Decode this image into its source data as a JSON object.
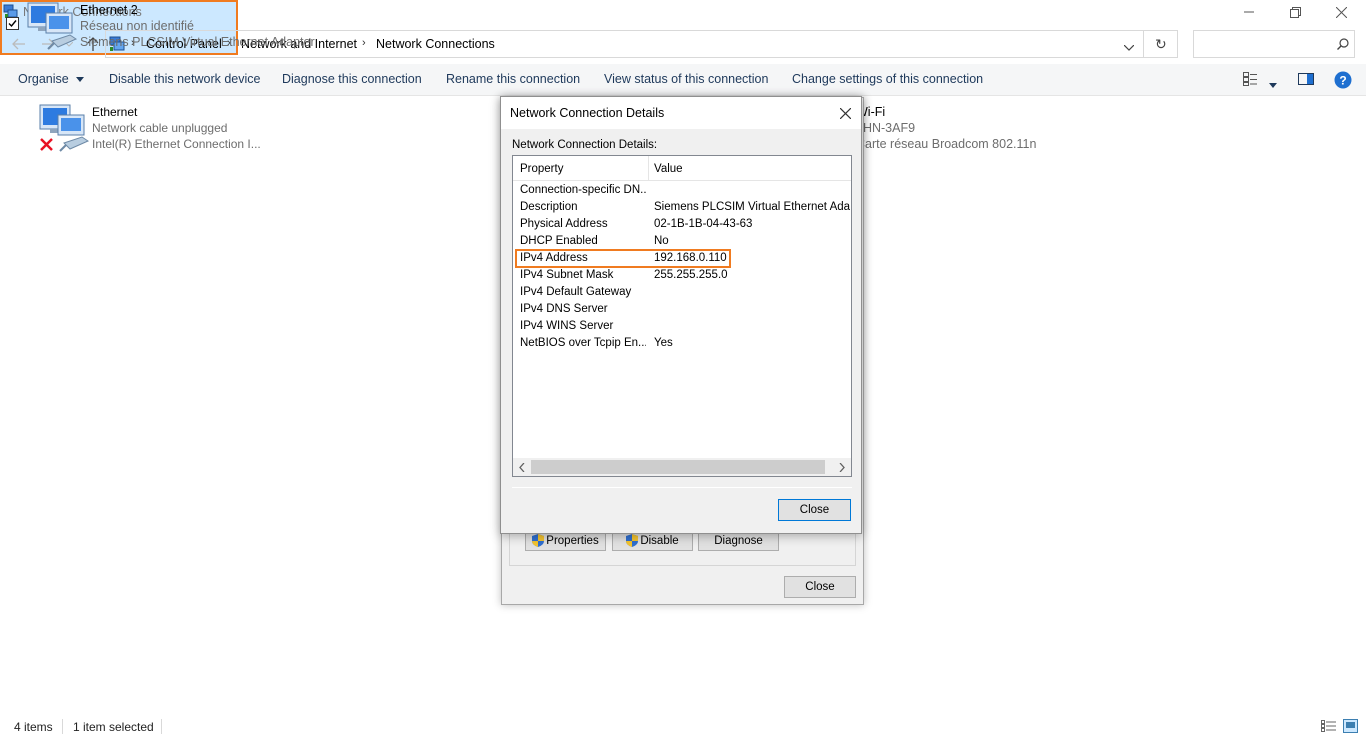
{
  "window": {
    "title": "Network Connections",
    "minimize_icon": "minimize-icon",
    "restore_icon": "restore-icon",
    "close_icon": "close-icon"
  },
  "address": {
    "breadcrumbs": [
      "Control Panel",
      "Network and Internet",
      "Network Connections"
    ],
    "search_placeholder": ""
  },
  "toolbar": {
    "commands": [
      "Organise",
      "Disable this network device",
      "Diagnose this connection",
      "Rename this connection",
      "View status of this connection",
      "Change settings of this connection"
    ]
  },
  "connections": [
    {
      "name": "Ethernet",
      "status": "Network cable unplugged",
      "adapter": "Intel(R) Ethernet Connection I..."
    },
    {
      "name": "Ethernet 2",
      "status": "Réseau non identifié",
      "adapter": "Siemens PLCSIM Virtual Ethernet Adapter",
      "selected": true
    },
    {
      "name": "Wi-Fi",
      "status": "LHN-3AF9",
      "adapter": "Carte réseau Broadcom 802.11n"
    }
  ],
  "status_dialog": {
    "buttons": [
      "Properties",
      "Disable",
      "Diagnose"
    ],
    "close_label": "Close"
  },
  "details_dialog": {
    "title": "Network Connection Details",
    "label": "Network Connection Details:",
    "columns": [
      "Property",
      "Value"
    ],
    "rows": [
      {
        "property": "Connection-specific DN...",
        "value": ""
      },
      {
        "property": "Description",
        "value": "Siemens PLCSIM Virtual Ethernet Adapter"
      },
      {
        "property": "Physical Address",
        "value": "02-1B-1B-04-43-63"
      },
      {
        "property": "DHCP Enabled",
        "value": "No"
      },
      {
        "property": "IPv4 Address",
        "value": "192.168.0.110"
      },
      {
        "property": "IPv4 Subnet Mask",
        "value": "255.255.255.0"
      },
      {
        "property": "IPv4 Default Gateway",
        "value": ""
      },
      {
        "property": "IPv4 DNS Server",
        "value": ""
      },
      {
        "property": "IPv4 WINS Server",
        "value": ""
      },
      {
        "property": "NetBIOS over Tcpip En...",
        "value": "Yes"
      }
    ],
    "close_label": "Close"
  },
  "statusbar": {
    "items_count": "4 items",
    "selected_count": "1 item selected"
  },
  "colors": {
    "highlight": "#f07b20",
    "selection": "#cce8ff",
    "command_text": "#1e395b"
  }
}
